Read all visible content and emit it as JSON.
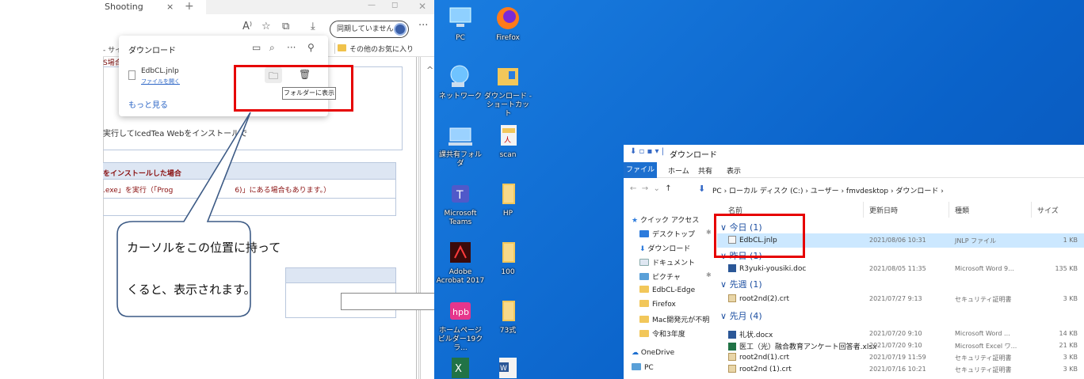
{
  "browser": {
    "tab_title": "Shooting",
    "tab_close": "×",
    "tab_new": "+",
    "win_min": "—",
    "win_max": "◻",
    "win_close": "✕",
    "sync_label": "同期していません",
    "more": "···",
    "bookmark_site": "- サイ",
    "bookmark_other": "その他のお気に入り",
    "page": {
      "red_note": "S場合",
      "iced_text": "実行してIcedTea Webをインストールで",
      "sec2_title": "をインストールした場合",
      "sec2_text": ".exe」を実行（「Prog",
      "sec2_text_end": "6)」にある場合もあります。）"
    }
  },
  "download_panel": {
    "title": "ダウンロード",
    "file_name": "EdbCL.jnlp",
    "open_file": "ファイルを開く",
    "see_more": "もっと見る",
    "tooltip": "フォルダーに表示"
  },
  "callout": {
    "line1": "カーソルをこの位置に持って",
    "line2": "くると、表示されます。"
  },
  "desktop": {
    "icons": [
      {
        "label": "PC"
      },
      {
        "label": "Firefox"
      },
      {
        "label": "ネットワーク"
      },
      {
        "label": "ダウンロード - ショートカット"
      },
      {
        "label": "課共有フォルダ"
      },
      {
        "label": "scan"
      },
      {
        "label": "Microsoft Teams"
      },
      {
        "label": "HP"
      },
      {
        "label": "Adobe Acrobat 2017"
      },
      {
        "label": "100"
      },
      {
        "label": "ホームページビルダー19クラ..."
      },
      {
        "label": "73式"
      }
    ]
  },
  "explorer": {
    "title": "ダウンロード",
    "ribbon": {
      "file": "ファイル",
      "home": "ホーム",
      "share": "共有",
      "view": "表示"
    },
    "path": "PC › ローカル ディスク (C:) › ユーザー › fmvdesktop › ダウンロード ›",
    "nav": {
      "quick_access": "クイック アクセス",
      "desktop": "デスクトップ",
      "downloads": "ダウンロード",
      "documents": "ドキュメント",
      "pictures": "ピクチャ",
      "f1": "EdbCL-Edge",
      "f2": "Firefox",
      "f3": "Mac開発元が不明",
      "f4": "令和3年度",
      "onedrive": "OneDrive",
      "pc": "PC"
    },
    "columns": {
      "name": "名前",
      "date": "更新日時",
      "type": "種類",
      "size": "サイズ"
    },
    "groups": {
      "today": "今日 (1)",
      "yesterday": "昨日 (1)",
      "last_week": "先週 (1)",
      "last_month": "先月 (4)"
    },
    "rows": [
      {
        "name": "EdbCL.jnlp",
        "date": "2021/08/06 10:31",
        "type": "JNLP ファイル",
        "size": "1 KB"
      },
      {
        "name": "R3yuki-yousiki.doc",
        "date": "2021/08/05 11:35",
        "type": "Microsoft Word 9...",
        "size": "135 KB"
      },
      {
        "name": "root2nd(2).crt",
        "date": "2021/07/27 9:13",
        "type": "セキュリティ証明書",
        "size": "3 KB"
      },
      {
        "name": "礼状.docx",
        "date": "2021/07/20 9:10",
        "type": "Microsoft Word ...",
        "size": "14 KB"
      },
      {
        "name": "医工（光）融合教育アンケート回答者.xlsx",
        "date": "2021/07/20 9:10",
        "type": "Microsoft Excel ワ...",
        "size": "21 KB"
      },
      {
        "name": "root2nd(1).crt",
        "date": "2021/07/19 11:59",
        "type": "セキュリティ証明書",
        "size": "3 KB"
      },
      {
        "name": "root2nd (1).crt",
        "date": "2021/07/16 10:21",
        "type": "セキュリティ証明書",
        "size": "3 KB"
      }
    ]
  }
}
